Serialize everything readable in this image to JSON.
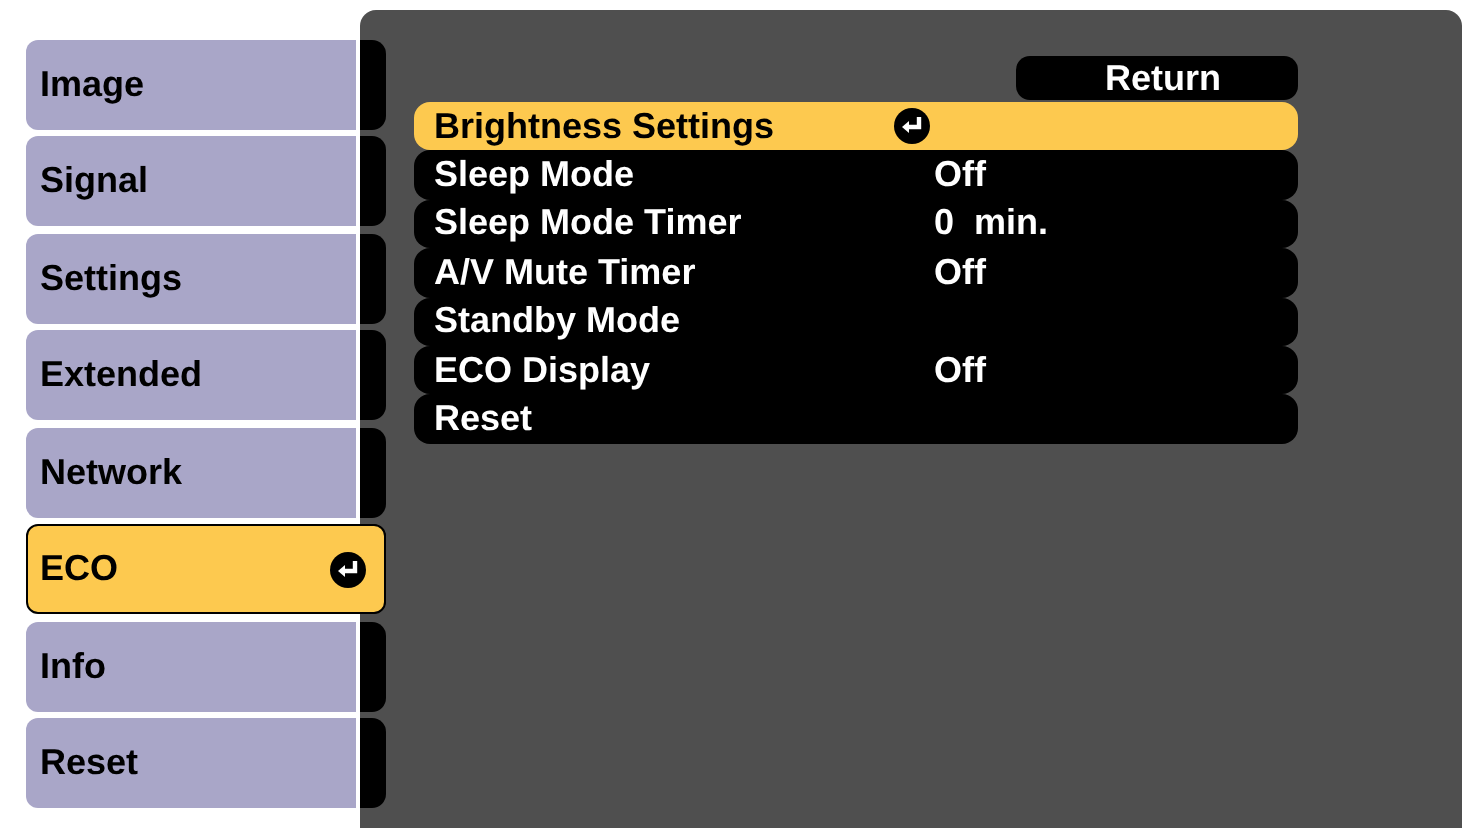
{
  "tabs": [
    {
      "label": "Image",
      "selected": false
    },
    {
      "label": "Signal",
      "selected": false
    },
    {
      "label": "Settings",
      "selected": false
    },
    {
      "label": "Extended",
      "selected": false
    },
    {
      "label": "Network",
      "selected": false
    },
    {
      "label": "ECO",
      "selected": true
    },
    {
      "label": "Info",
      "selected": false
    },
    {
      "label": "Reset",
      "selected": false
    }
  ],
  "return_button": "Return",
  "items": [
    {
      "label": "Brightness Settings",
      "selected": true
    },
    {
      "label": "Sleep Mode",
      "value": "Off",
      "selected": false
    },
    {
      "label": "Sleep Mode Timer",
      "value": "0  min.",
      "selected": false
    },
    {
      "label": "A/V Mute Timer",
      "value": "Off",
      "selected": false
    },
    {
      "label": "Standby Mode",
      "selected": false
    },
    {
      "label": "ECO Display",
      "value": "Off",
      "selected": false
    },
    {
      "label": "Reset",
      "selected": false
    }
  ]
}
